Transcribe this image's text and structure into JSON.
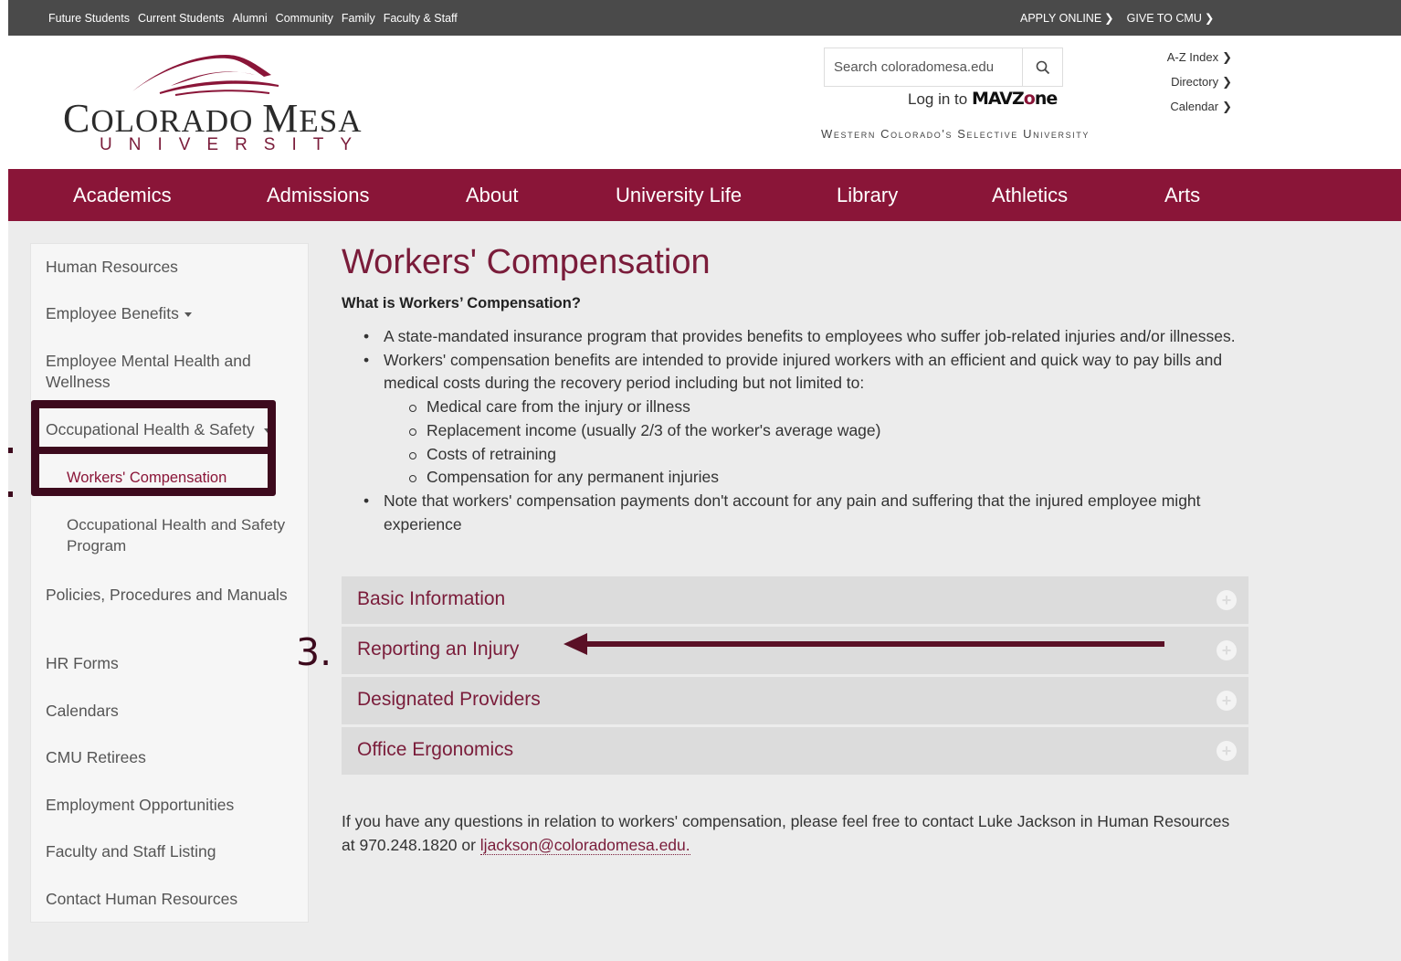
{
  "topbar": {
    "links": [
      "Future Students",
      "Current Students",
      "Alumni",
      "Community",
      "Family",
      "Faculty & Staff"
    ],
    "apply_label": "APPLY ONLINE",
    "give_label": "GIVE TO CMU"
  },
  "logo": {
    "word_big_c": "C",
    "word_rest_1": "OLORADO ",
    "word_big_m": "M",
    "word_rest_2": "ESA",
    "sub": "UNIVERSITY"
  },
  "search": {
    "placeholder": "Search coloradomesa.edu"
  },
  "login": {
    "prefix": "Log in to ",
    "brand_a": "MAVZ",
    "brand_b": "ne",
    "brand_o": "o"
  },
  "quick_links": [
    "A-Z Index",
    "Directory",
    "Calendar"
  ],
  "tagline": "Western Colorado's Selective University",
  "nav": [
    "Academics",
    "Admissions",
    "About",
    "University Life",
    "Library",
    "Athletics",
    "Arts"
  ],
  "sidebar": {
    "items": [
      "Human Resources",
      "Employee Benefits",
      "Employee Mental Health and Wellness",
      "Occupational Health & Safety",
      "Workers' Compensation",
      "Occupational Health and Safety Program",
      "Policies, Procedures and Manuals",
      "HR Forms",
      "Calendars",
      "CMU Retirees",
      "Employment Opportunities",
      "Faculty and Staff Listing",
      "Contact Human Resources"
    ]
  },
  "content": {
    "title": "Workers' Compensation",
    "question": "What is Workers’ Compensation?",
    "bullet_1": "A state-mandated insurance program that provides benefits to employees who suffer job-related injuries and/or illnesses.",
    "bullet_2": "Workers' compensation benefits are intended to provide injured workers with an efficient and quick way to pay bills and medical costs during the recovery period including but not limited to:",
    "sub_bullets": [
      "Medical care from the injury or illness",
      "Replacement income (usually 2/3 of the worker's average wage)",
      "Costs of retraining",
      "Compensation for any permanent injuries"
    ],
    "bullet_3": "Note that workers' compensation payments don't account for any pain and suffering that the injured employee might experience",
    "accordions": [
      "Basic Information",
      "Reporting an Injury",
      "Designated Providers",
      "Office Ergonomics"
    ],
    "contact_text": "If you have any questions in relation to workers' compensation, please feel free to contact Luke Jackson in Human Resources at 970.248.1820 or ",
    "contact_email": "ljackson@coloradomesa.edu."
  },
  "annotations": {
    "step_3": "3."
  },
  "colors": {
    "maroon": "#8a1538",
    "annotation": "#3d0a1d",
    "topbar": "#4a4a4a"
  }
}
